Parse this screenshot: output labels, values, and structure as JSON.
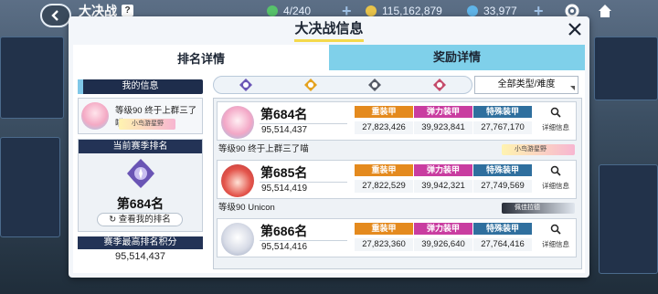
{
  "topbar": {
    "title": "大决战",
    "help_badge": "?",
    "stamina": "4/240",
    "gold": "115,162,879",
    "crystal": "33,977"
  },
  "modal": {
    "title": "大决战信息",
    "tabs": [
      {
        "label": "排名详情",
        "active": true
      },
      {
        "label": "奖励详情",
        "active": false
      }
    ]
  },
  "left_panel": {
    "my_info_header": "我的信息",
    "level_text": "等级90 终于上群三了喵",
    "namecard_text": "小鸟游星野",
    "season_rank_header": "当前赛季排名",
    "season_rank": "第684名",
    "view_rank_button": "查看我的排名",
    "best_score_header": "赛季最高排名积分",
    "best_score": "95,514,437"
  },
  "filters": {
    "dropdown_label": "全部类型/难度",
    "icon_colors": [
      "#6a55b5",
      "#e4a21e",
      "#555a66",
      "#c44a6a"
    ]
  },
  "rows": [
    {
      "rank": "第684名",
      "score": "95,514,437",
      "armor_labels": [
        "重装甲",
        "弹力装甲",
        "特殊装甲"
      ],
      "armor_values": [
        "27,823,426",
        "39,923,841",
        "27,767,170"
      ],
      "detail_label": "详细信息",
      "player_line": "等级90 终于上群三了喵",
      "namecard": "小鸟游星野",
      "namecard_style": "light"
    },
    {
      "rank": "第685名",
      "score": "95,514,419",
      "armor_labels": [
        "重装甲",
        "弹力装甲",
        "特殊装甲"
      ],
      "armor_values": [
        "27,822,529",
        "39,942,321",
        "27,749,569"
      ],
      "detail_label": "详细信息",
      "player_line": "等级90 Unicon",
      "namecard": "佩佳拉德",
      "namecard_style": "dark"
    },
    {
      "rank": "第686名",
      "score": "95,514,416",
      "armor_labels": [
        "重装甲",
        "弹力装甲",
        "特殊装甲"
      ],
      "armor_values": [
        "27,823,360",
        "39,926,640",
        "27,764,416"
      ],
      "detail_label": "详细信息"
    }
  ],
  "colors": {
    "heavy": "#e48a1e",
    "elastic": "#c93da0",
    "special": "#2f6f9e",
    "tab_inactive": "#7fd0ea",
    "title_underline": "#f4d94b"
  }
}
